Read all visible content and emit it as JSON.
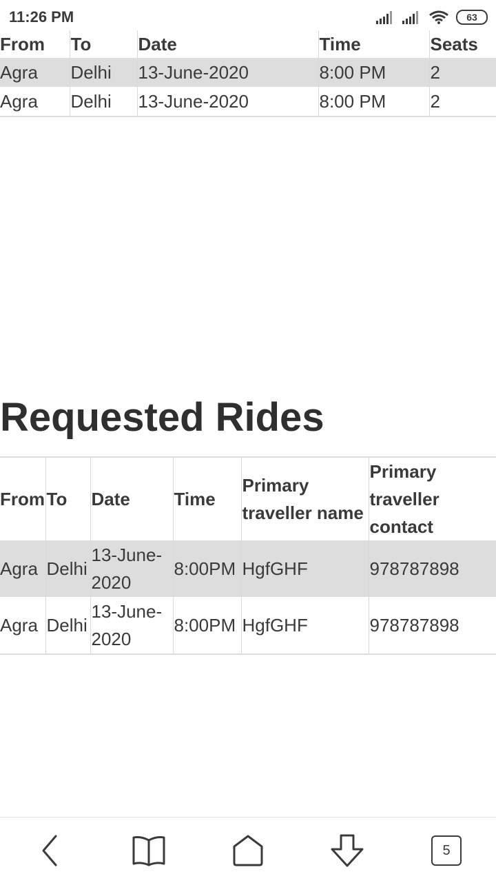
{
  "status_bar": {
    "time": "11:26 PM",
    "battery": "63",
    "icons": [
      "signal-icon",
      "signal-icon",
      "wifi-icon",
      "battery-icon"
    ]
  },
  "offered_rides": {
    "columns": [
      "From",
      "To",
      "Date",
      "Time",
      "Seats"
    ],
    "rows": [
      [
        "Agra",
        "Delhi",
        "13-June-2020",
        "8:00 PM",
        "2"
      ],
      [
        "Agra",
        "Delhi",
        "13-June-2020",
        "8:00 PM",
        "2"
      ]
    ]
  },
  "requested_rides": {
    "title": "Requested Rides",
    "columns": [
      "From",
      "To",
      "Date",
      "Time",
      "Primary traveller name",
      "Primary traveller contact"
    ],
    "rows": [
      [
        "Agra",
        "Delhi",
        "13-June-2020",
        "8:00PM",
        "HgfGHF",
        "978787898"
      ],
      [
        "Agra",
        "Delhi",
        "13-June-2020",
        "8:00PM",
        "HgfGHF",
        "978787898"
      ]
    ]
  },
  "bottom_nav": {
    "items": [
      "back-icon",
      "bookmarks-icon",
      "home-icon",
      "download-icon",
      "tabs-icon"
    ],
    "tab_count": "5"
  }
}
